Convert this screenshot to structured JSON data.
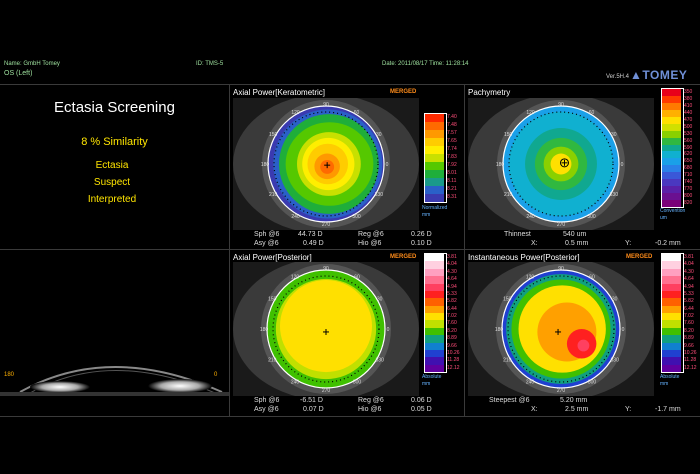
{
  "header": {
    "name": "Name: GmbH Tomey",
    "id": "ID: TMS-5",
    "date": "Date: 2011/08/17   Time: 11:28:14",
    "eye": "OS (Left)",
    "version": "Ver.5H.4",
    "brand": "TOMEY"
  },
  "screening": {
    "title": "Ectasia Screening",
    "similarity": "8 % Similarity",
    "result_lines": [
      "Ectasia",
      "Suspect",
      "Interpreted"
    ]
  },
  "panels": {
    "axial_kerato": {
      "title": "Axial Power[Keratometric]",
      "merged": "MERGED",
      "scale": [
        "7.40",
        "7.48",
        "7.57",
        "7.65",
        "7.74",
        "7.83",
        "7.92",
        "8.01",
        "8.11",
        "8.21",
        "8.31"
      ],
      "scale_caption": [
        "Normalized",
        "mm"
      ],
      "stats": {
        "sph_label": "Sph @6",
        "sph_value": "44.73 D",
        "reg_label": "Reg @6",
        "reg_value": "0.26 D",
        "asy_label": "Asy @6",
        "asy_value": "0.49 D",
        "hio_label": "Hio @6",
        "hio_value": "0.10 D"
      }
    },
    "pachymetry": {
      "title": "Pachymetry",
      "scale": [
        "350",
        "380",
        "410",
        "440",
        "470",
        "500",
        "530",
        "560",
        "590",
        "620",
        "650",
        "680",
        "710",
        "740",
        "770",
        "800",
        "820"
      ],
      "scale_caption": [
        "Convention",
        "um"
      ],
      "stats": {
        "thinnest_label": "Thinnest",
        "thinnest_value": "540 um",
        "x_label": "X:",
        "x_value": "0.5 mm",
        "y_label": "Y:",
        "y_value": "-0.2 mm"
      }
    },
    "axial_posterior": {
      "title": "Axial Power[Posterior]",
      "merged": "MERGED",
      "scale": [
        "3.81",
        "4.04",
        "4.30",
        "4.64",
        "4.94",
        "5.33",
        "5.82",
        "6.44",
        "7.02",
        "7.60",
        "8.20",
        "8.89",
        "9.66",
        "10.26",
        "11.28",
        "12.12"
      ],
      "scale_caption": [
        "Absolute",
        "mm"
      ],
      "stats": {
        "sph_label": "Sph @6",
        "sph_value": "-6.51 D",
        "reg_label": "Reg @6",
        "reg_value": "0.06 D",
        "asy_label": "Asy @6",
        "asy_value": "0.07 D",
        "hio_label": "Hio @6",
        "hio_value": "0.05 D"
      }
    },
    "inst_posterior": {
      "title": "Instantaneous Power[Posterior]",
      "merged": "MERGED",
      "scale": [
        "3.81",
        "4.04",
        "4.30",
        "4.64",
        "4.94",
        "5.33",
        "5.82",
        "6.44",
        "7.02",
        "7.60",
        "8.20",
        "8.89",
        "9.66",
        "10.26",
        "11.28",
        "12.12"
      ],
      "scale_caption": [
        "Absolute",
        "mm"
      ],
      "stats": {
        "steepest_label": "Steepest @6",
        "steepest_value": "5.20 mm",
        "x_label": "X:",
        "x_value": "2.5 mm",
        "y_label": "Y:",
        "y_value": "-1.7 mm"
      }
    }
  },
  "hours": [
    "0",
    "15",
    "30",
    "45",
    "60",
    "75",
    "90",
    "105",
    "120",
    "135",
    "150",
    "165",
    "180",
    "195",
    "210",
    "225",
    "240",
    "255",
    "270",
    "285",
    "300",
    "315",
    "330",
    "345"
  ],
  "scheimpflug": {
    "left_label": "180",
    "right_label": "0"
  },
  "colors": {
    "kerato": [
      "#ff2a00",
      "#ff6a00",
      "#ff9900",
      "#ffcc00",
      "#ffee00",
      "#c8e000",
      "#55c800",
      "#1fae3a",
      "#1a9a8a",
      "#2a60c8",
      "#3a3ab0"
    ],
    "pachy": [
      "#e8001a",
      "#ff3a00",
      "#ff7a00",
      "#ffb000",
      "#ffe000",
      "#d0e000",
      "#8ad000",
      "#30b840",
      "#10a890",
      "#10b0d0",
      "#1aa0e8",
      "#2a80e8",
      "#3a58d8",
      "#4a38c0",
      "#5a20a8",
      "#6a1090",
      "#7a0078"
    ],
    "absolute": [
      "#ffffff",
      "#ffd0e0",
      "#ffa0c0",
      "#ff7090",
      "#ff4060",
      "#ff2020",
      "#ff6000",
      "#ffa000",
      "#ffe000",
      "#c0e000",
      "#40c000",
      "#10a080",
      "#1080d0",
      "#2040d0",
      "#4010b0",
      "#6000a0"
    ]
  }
}
